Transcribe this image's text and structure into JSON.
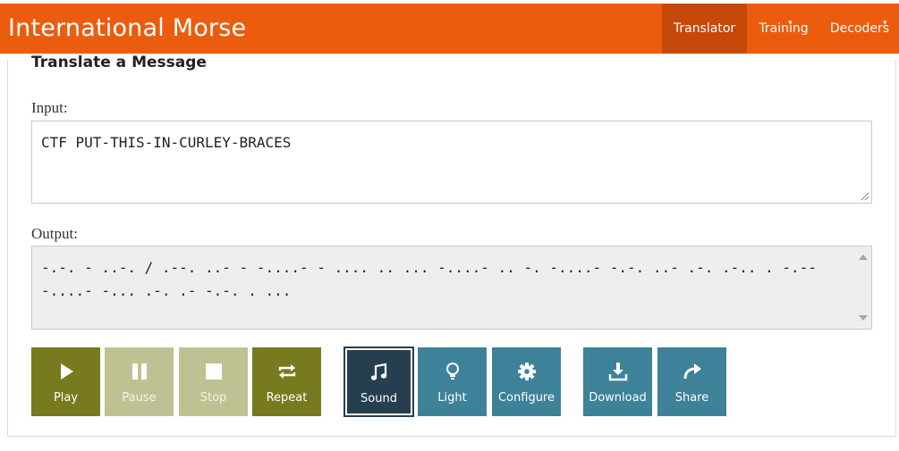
{
  "header": {
    "brand": "International Morse",
    "nav": [
      {
        "label": "Translator",
        "active": true
      },
      {
        "label": "Training",
        "caret": "▾"
      },
      {
        "label": "Decoders",
        "caret": "▾"
      }
    ]
  },
  "panel": {
    "title": "Translate a Message",
    "input_label": "Input:",
    "input_value": "CTF PUT-THIS-IN-CURLEY-BRACES",
    "output_label": "Output:",
    "output_value": "-.-. - ..-. / .--. ..- - -....- - .... .. ... -....- .. -. -....- -.-. ..- .-. .-.. . -.-- -....- -... .-. .- -.-. . ..."
  },
  "controls": {
    "play": "Play",
    "pause": "Pause",
    "stop": "Stop",
    "repeat": "Repeat",
    "sound": "Sound",
    "light": "Light",
    "configure": "Configure",
    "download": "Download",
    "share": "Share"
  },
  "colors": {
    "header": "#ec5c0f",
    "nav_active": "#c6490a",
    "olive": "#787a1f",
    "olive_disabled": "#bfc193",
    "teal": "#3d8299",
    "selected": "#263f4e"
  }
}
